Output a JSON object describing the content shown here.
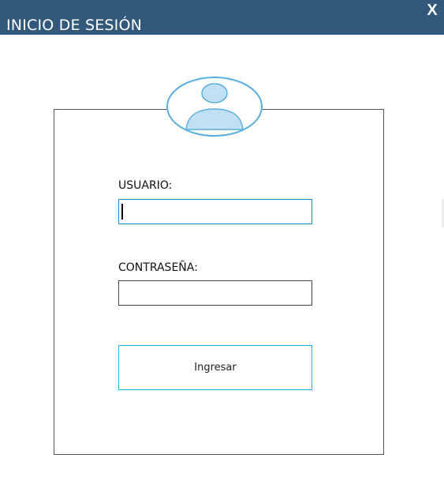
{
  "window": {
    "title": "INICIO DE SESIÓN",
    "close_label": "X",
    "colors": {
      "titlebar": "#33597a",
      "accent_border": "#1e88c8",
      "button_border": "#22b5de",
      "avatar_fill": "#bfe0f5",
      "avatar_stroke": "#5aaedc"
    }
  },
  "login": {
    "avatar_icon": "user-avatar-icon",
    "username_label": "USUARIO:",
    "username_value": "",
    "password_label": "CONTRASEÑA:",
    "password_value": "",
    "submit_label": "Ingresar"
  }
}
